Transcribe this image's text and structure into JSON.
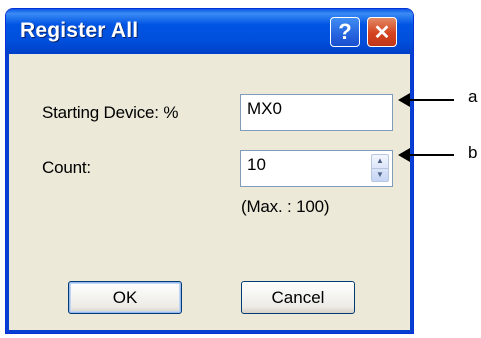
{
  "dialog": {
    "title": "Register All",
    "help_glyph": "?",
    "close_glyph": "✕"
  },
  "fields": {
    "starting_device_label": "Starting Device: %",
    "starting_device_value": "MX0",
    "count_label": "Count:",
    "count_value": "10",
    "max_note": "(Max. : 100)"
  },
  "buttons": {
    "ok": "OK",
    "cancel": "Cancel"
  },
  "annotations": {
    "a": "a",
    "b": "b"
  },
  "colors": {
    "titlebar": "#0054e3",
    "dialog_bg": "#ece9d8",
    "close_button": "#d44320"
  },
  "icons": {
    "help": "question-mark",
    "close": "x-mark",
    "spinner_up": "triangle-up",
    "spinner_down": "triangle-down",
    "callout": "left-arrow"
  }
}
